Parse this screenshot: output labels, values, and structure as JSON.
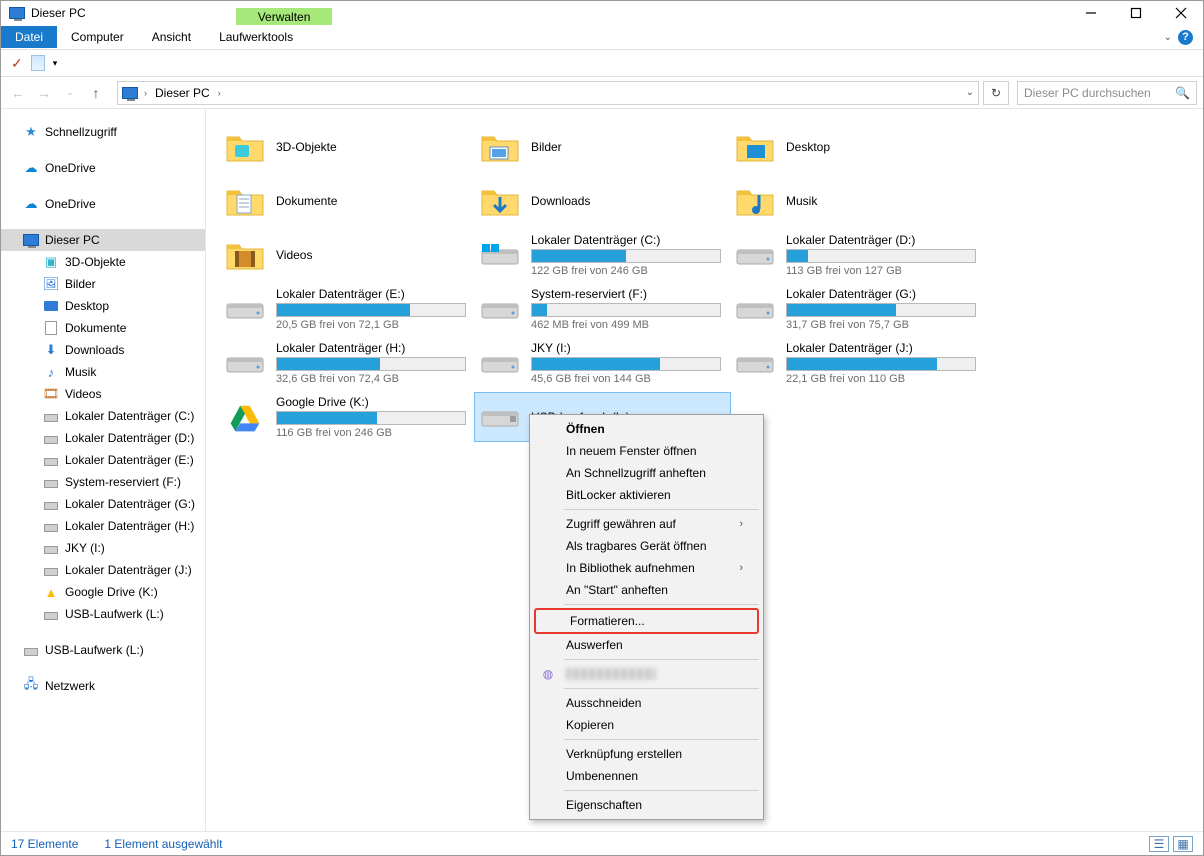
{
  "title": "Dieser PC",
  "contextual_group": "Verwalten",
  "ribbon": {
    "file": "Datei",
    "computer": "Computer",
    "view": "Ansicht",
    "drive_tools": "Laufwerktools"
  },
  "address": {
    "root": "Dieser PC",
    "search_placeholder": "Dieser PC durchsuchen"
  },
  "sidebar": {
    "quick_access": "Schnellzugriff",
    "onedrive1": "OneDrive",
    "onedrive2": "OneDrive",
    "this_pc": "Dieser PC",
    "children": [
      "3D-Objekte",
      "Bilder",
      "Desktop",
      "Dokumente",
      "Downloads",
      "Musik",
      "Videos",
      "Lokaler Datenträger (C:)",
      "Lokaler Datenträger (D:)",
      "Lokaler Datenträger (E:)",
      "System-reserviert (F:)",
      "Lokaler Datenträger (G:)",
      "Lokaler Datenträger (H:)",
      "JKY (I:)",
      "Lokaler Datenträger (J:)",
      "Google Drive (K:)",
      "USB-Laufwerk (L:)"
    ],
    "usb_detached": "USB-Laufwerk (L:)",
    "network": "Netzwerk"
  },
  "folders": [
    {
      "name": "3D-Objekte"
    },
    {
      "name": "Bilder"
    },
    {
      "name": "Desktop"
    },
    {
      "name": "Dokumente"
    },
    {
      "name": "Downloads"
    },
    {
      "name": "Musik"
    },
    {
      "name": "Videos"
    }
  ],
  "drives": [
    {
      "name": "Lokaler Datenträger (C:)",
      "sub": "122 GB frei von 246 GB",
      "pct": 50
    },
    {
      "name": "Lokaler Datenträger (D:)",
      "sub": "113 GB frei von 127 GB",
      "pct": 11
    },
    {
      "name": "Lokaler Datenträger (E:)",
      "sub": "20,5 GB frei von 72,1 GB",
      "pct": 71
    },
    {
      "name": "System-reserviert (F:)",
      "sub": "462 MB frei von 499 MB",
      "pct": 8
    },
    {
      "name": "Lokaler Datenträger (G:)",
      "sub": "31,7 GB frei von 75,7 GB",
      "pct": 58
    },
    {
      "name": "Lokaler Datenträger (H:)",
      "sub": "32,6 GB frei von 72,4 GB",
      "pct": 55
    },
    {
      "name": "JKY (I:)",
      "sub": "45,6 GB frei von 144 GB",
      "pct": 68
    },
    {
      "name": "Lokaler Datenträger (J:)",
      "sub": "22,1 GB frei von 110 GB",
      "pct": 80
    },
    {
      "name": "Google Drive (K:)",
      "sub": "116 GB frei von 246 GB",
      "pct": 53,
      "icon": "gdrive"
    },
    {
      "name": "USB-Laufwerk (L:)",
      "sub": "",
      "pct": 0,
      "selected": true,
      "icon": "usb"
    }
  ],
  "context_menu": {
    "open": "Öffnen",
    "open_new_window": "In neuem Fenster öffnen",
    "pin_quick": "An Schnellzugriff anheften",
    "bitlocker": "BitLocker aktivieren",
    "grant_access": "Zugriff gewähren auf",
    "open_portable": "Als tragbares Gerät öffnen",
    "include_library": "In Bibliothek aufnehmen",
    "pin_start": "An \"Start\" anheften",
    "format": "Formatieren...",
    "eject": "Auswerfen",
    "cut": "Ausschneiden",
    "copy": "Kopieren",
    "create_shortcut": "Verknüpfung erstellen",
    "rename": "Umbenennen",
    "properties": "Eigenschaften"
  },
  "status": {
    "count": "17 Elemente",
    "selection": "1 Element ausgewählt"
  }
}
